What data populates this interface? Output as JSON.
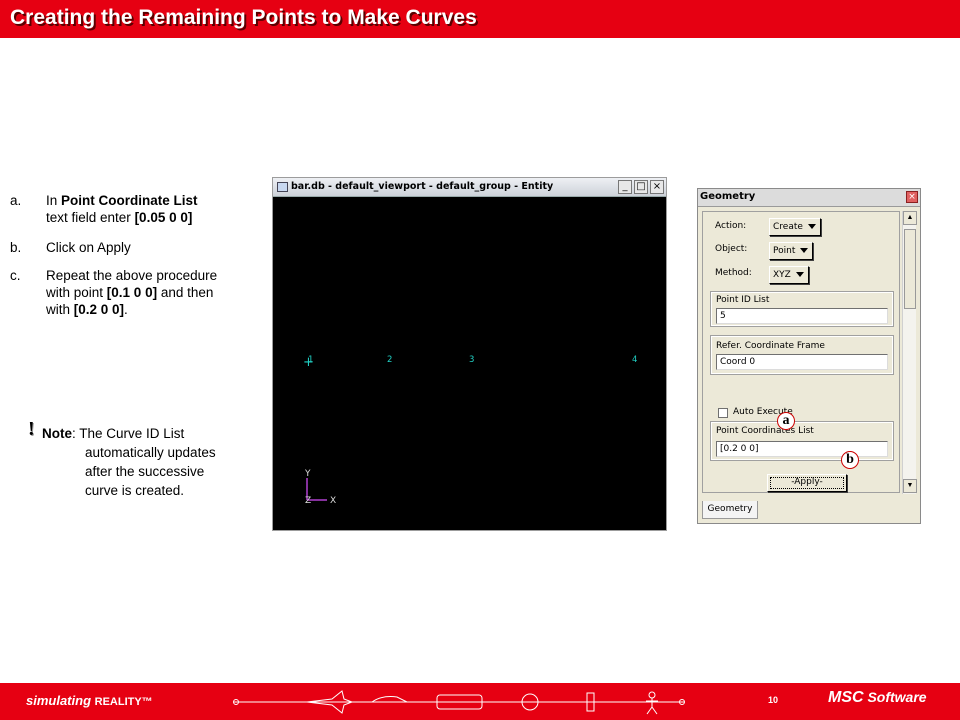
{
  "title": "Creating the Remaining Points to Make Curves",
  "steps": [
    {
      "letter": "a.",
      "parts": [
        "In ",
        "Point Coordinate List",
        " text field enter ",
        "[0.05 0 0]"
      ]
    },
    {
      "letter": "b.",
      "text": "Click on Apply"
    },
    {
      "letter": "c.",
      "parts": [
        "Repeat the above procedure with point ",
        "[0.1 0 0]",
        " and then with ",
        "[0.2 0 0]",
        "."
      ]
    }
  ],
  "note": {
    "icon": "!",
    "label": "Note",
    "lines": [
      ": The Curve ID List",
      "automatically updates",
      "after the successive",
      "curve is created."
    ]
  },
  "viewport": {
    "title": "bar.db - default_viewport - default_group - Entity",
    "buttons": [
      "_",
      "□",
      "×"
    ],
    "points": [
      "1",
      "2",
      "3",
      "4"
    ],
    "axes": {
      "y": "Y",
      "z": "Z",
      "x": "X"
    }
  },
  "panel": {
    "title": "Geometry",
    "close": "×",
    "action_label": "Action:",
    "action_value": "Create",
    "object_label": "Object:",
    "object_value": "Point",
    "method_label": "Method:",
    "method_value": "XYZ",
    "point_id_label": "Point ID List",
    "point_id_value": "5",
    "coord_frame_label": "Refer. Coordinate Frame",
    "coord_frame_value": "Coord 0",
    "auto_execute_label": "Auto Execute",
    "point_coords_label": "Point Coordinates List",
    "point_coords_value": "[0.2 0 0]",
    "apply_label": "-Apply-",
    "tab_label": "Geometry"
  },
  "callouts": {
    "a": "a",
    "b": "b"
  },
  "footer": {
    "brand_main": "simulating ",
    "brand_reality": "REALITY™",
    "page_number": "10",
    "logo_msc": "MSC",
    "logo_software": "Software"
  },
  "colors": {
    "accent": "#e60012",
    "viewport_bg": "#000000",
    "point_label": "#21d1c5"
  }
}
